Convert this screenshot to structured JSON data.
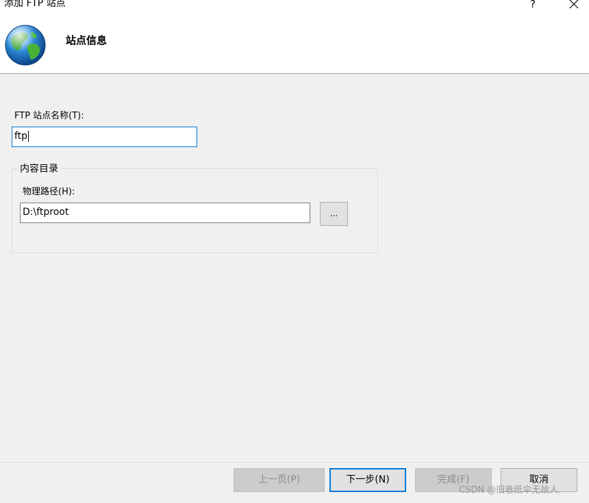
{
  "window": {
    "title": "添加 FTP 站点",
    "help_label": "?",
    "close_icon": "close-icon"
  },
  "header": {
    "icon": "globe-icon",
    "title": "站点信息"
  },
  "form": {
    "site_name_label": "FTP 站点名称(T):",
    "site_name_value": "ftp",
    "content_group_label": "内容目录",
    "physical_path_label": "物理路径(H):",
    "physical_path_value": "D:\\ftproot",
    "browse_label": "..."
  },
  "buttons": {
    "prev": "上一页(P)",
    "next": "下一步(N)",
    "finish": "完成(F)",
    "cancel": "取消"
  },
  "watermark": "CSDN @旧巷纸伞无故人.",
  "colors": {
    "background": "#f0f0f0",
    "header_background": "#ffffff",
    "focus_border": "#0078d7"
  }
}
